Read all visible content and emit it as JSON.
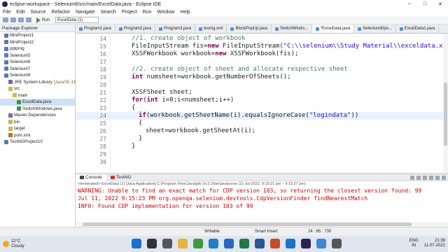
{
  "window": {
    "title": "eclipse-workspace - Selenium8/src/main/ExcelData.java - Eclipse IDE",
    "controls": [
      "–",
      "□",
      "✕"
    ]
  },
  "menu": [
    "File",
    "Edit",
    "Source",
    "Refactor",
    "Navigate",
    "Search",
    "Project",
    "Run",
    "Window",
    "Help"
  ],
  "toolbar": {
    "run_label": "Run",
    "launch_combo": "ExcelData (1)"
  },
  "package_explorer": {
    "title": "Package Explorer",
    "items": [
      {
        "label": "MiniProject1",
        "icon": "project-icon",
        "indent": 1
      },
      {
        "label": "MiniProject2",
        "icon": "project-icon",
        "indent": 1
      },
      {
        "label": "pplprog",
        "icon": "project-icon",
        "indent": 1
      },
      {
        "label": "Selenium5",
        "icon": "project-icon",
        "indent": 1
      },
      {
        "label": "Selenium6",
        "icon": "project-icon",
        "indent": 1
      },
      {
        "label": "Selenium7",
        "icon": "project-icon",
        "indent": 1
      },
      {
        "label": "Selenium8",
        "icon": "project-icon",
        "indent": 1
      },
      {
        "label": "JRE System Library",
        "suffix": "[JavaSE-16]",
        "icon": "library-icon",
        "indent": 2
      },
      {
        "label": "src",
        "icon": "folder-icon",
        "indent": 2
      },
      {
        "label": "main",
        "icon": "package-icon",
        "indent": 3
      },
      {
        "label": "ExcelData.java",
        "icon": "java-file-icon",
        "indent": 4,
        "selected": true
      },
      {
        "label": "SwitchWindows.java",
        "icon": "java-file-icon",
        "indent": 4
      },
      {
        "label": "Maven Dependencies",
        "icon": "library-icon",
        "indent": 2
      },
      {
        "label": "bin",
        "icon": "folder-icon",
        "indent": 2
      },
      {
        "label": "target",
        "icon": "folder-icon",
        "indent": 2
      },
      {
        "label": "pom.xml",
        "icon": "xml-file-icon",
        "indent": 2
      },
      {
        "label": "TestNGProject10",
        "icon": "project-icon",
        "indent": 1
      }
    ]
  },
  "editor_tabs": [
    "Program1.java",
    "Program2.java",
    "Program3.java",
    "testng.xml",
    "BlockPopUp.java",
    "SwitchWindo...",
    "*ExcelData.java",
    "Selenium8/po...",
    "ExcelData1.java"
  ],
  "active_tab": 6,
  "code_lines": [
    {
      "n": "14",
      "indent": 2,
      "parts": [
        [
          "cm",
          "//1. create object of workbook"
        ]
      ]
    },
    {
      "n": "15",
      "indent": 2,
      "parts": [
        [
          "",
          "FileInputStream fis="
        ],
        [
          "kw",
          "new"
        ],
        [
          "",
          " FileInputStream("
        ],
        [
          "st",
          "\"C:\\\\selenium\\\\Study Material\\\\exceldata.xlsx\""
        ],
        [
          "",
          ");"
        ]
      ]
    },
    {
      "n": "16",
      "indent": 2,
      "parts": [
        [
          "",
          "XSSFWorkbook workbook="
        ],
        [
          "kw",
          "new"
        ],
        [
          "",
          " XSSFWorkbook(fis);"
        ]
      ]
    },
    {
      "n": "17",
      "indent": 0,
      "parts": []
    },
    {
      "n": "18",
      "indent": 2,
      "parts": [
        [
          "cm",
          "//2. create object of sheet and allocate respective sheet"
        ]
      ]
    },
    {
      "n": "19",
      "indent": 2,
      "parts": [
        [
          "kw",
          "int"
        ],
        [
          "",
          " numsheet=workbook.getNumberOfSheets();"
        ]
      ]
    },
    {
      "n": "20",
      "indent": 0,
      "parts": []
    },
    {
      "n": "21",
      "indent": 2,
      "parts": [
        [
          "",
          "XSSFSheet sheet;"
        ]
      ]
    },
    {
      "n": "22",
      "indent": 2,
      "parts": [
        [
          "kw",
          "for"
        ],
        [
          "",
          "("
        ],
        [
          "kw",
          "int"
        ],
        [
          "",
          " i=0;i<numsheet;i++)"
        ]
      ]
    },
    {
      "n": "23",
      "indent": 2,
      "parts": [
        [
          "",
          "{"
        ]
      ]
    },
    {
      "n": "24",
      "indent": 3,
      "parts": [
        [
          "kw",
          "if"
        ],
        [
          "",
          "(workbook.getSheetName(i).equalsIgnoreCase("
        ],
        [
          "st",
          "\"logindata\""
        ],
        [
          "",
          "))"
        ]
      ],
      "current": true
    },
    {
      "n": "25",
      "indent": 3,
      "parts": [
        [
          "",
          "{"
        ]
      ]
    },
    {
      "n": "26",
      "indent": 4,
      "parts": [
        [
          "",
          "sheet=workbook.getSheetAt(i);"
        ]
      ]
    },
    {
      "n": "27",
      "indent": 3,
      "parts": [
        [
          "",
          "}"
        ]
      ]
    },
    {
      "n": "28",
      "indent": 2,
      "parts": [
        [
          "",
          "}"
        ]
      ]
    },
    {
      "n": "29",
      "indent": 0,
      "parts": []
    },
    {
      "n": "30",
      "indent": 0,
      "parts": []
    }
  ],
  "console": {
    "tabs": [
      "Console",
      "TestNG"
    ],
    "terminated": "<terminated> ExcelData (1) [Java Application] C:\\Program Files\\Java\\jdk-16.0.2\\bin\\javaw.exe  (11-Jul-2022, 9:15:21 pm – 9:15:27 pm)",
    "lines": [
      "WARNING: Unable to find an exact match for CDP version 103, so returning the closest version found: 99",
      "Jul 11, 2022 9:15:23 PM org.openqa.selenium.devtools.CdpVersionFinder findNearestMatch",
      "INFO: Found CDP implementation for version 103 of 99"
    ]
  },
  "status": {
    "writable": "Writable",
    "insert": "Smart Insert",
    "position": "24 : 65 : 730"
  },
  "taskbar": {
    "temp": "22°C",
    "weather": "Cloudy",
    "lang1": "ENG",
    "lang2": "IN",
    "time": "21:39",
    "date": "11-07-2022",
    "apps": [
      "windows-start-icon",
      "search-icon",
      "task-view-icon",
      "file-explorer-icon",
      "chrome-icon",
      "edge-icon",
      "store-icon",
      "excel-icon",
      "word-icon",
      "powerpoint-icon",
      "mail-icon",
      "eclipse-icon",
      "notepad-icon",
      "camera-icon"
    ],
    "app_colors": [
      "#1a6fd0",
      "#333333",
      "#555555",
      "#e6b53a",
      "#3c9a3c",
      "#1f7fc4",
      "#2b66c4",
      "#1f7a45",
      "#2b579a",
      "#c84a27",
      "#1a73c8",
      "#2c2255",
      "#3a8ad4",
      "#555555"
    ]
  }
}
